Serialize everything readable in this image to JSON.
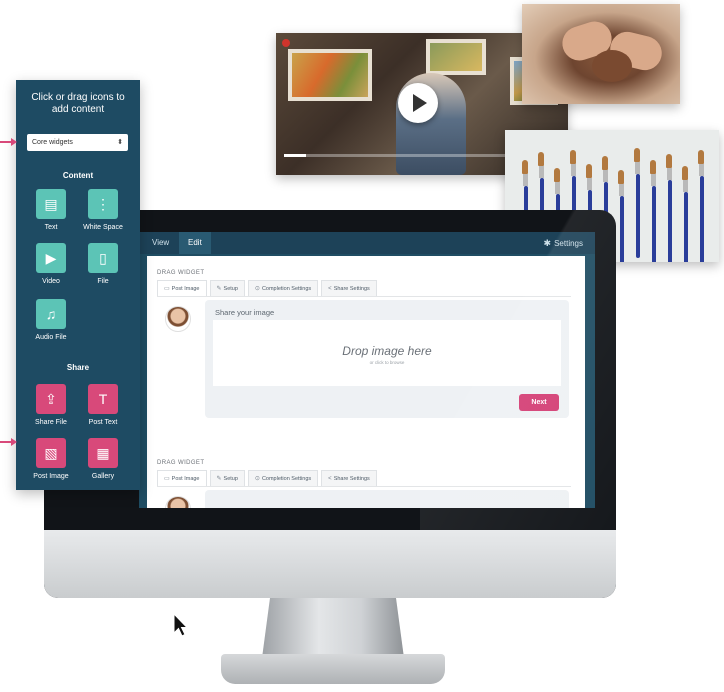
{
  "panel": {
    "title": "Click or drag icons to add content",
    "select_value": "Core widgets",
    "content_heading": "Content",
    "content_items": [
      {
        "label": "Text",
        "icon": "text-document-icon"
      },
      {
        "label": "White Space",
        "icon": "white-space-icon"
      },
      {
        "label": "Video",
        "icon": "video-icon"
      },
      {
        "label": "File",
        "icon": "file-icon"
      },
      {
        "label": "Audio File",
        "icon": "audio-file-icon"
      }
    ],
    "share_heading": "Share",
    "share_items": [
      {
        "label": "Share File",
        "icon": "share-file-icon"
      },
      {
        "label": "Post Text",
        "icon": "post-text-icon"
      },
      {
        "label": "Post Image",
        "icon": "post-image-icon"
      },
      {
        "label": "Gallery",
        "icon": "gallery-icon"
      }
    ]
  },
  "app": {
    "tabs": [
      "View",
      "Edit"
    ],
    "settings_label": "Settings",
    "widgets": [
      {
        "title": "DRAG WIDGET",
        "tabs": [
          "Post Image",
          "Setup",
          "Completion Settings",
          "Share Settings"
        ],
        "share_title": "Share your image",
        "drop_title": "Drop image here",
        "drop_sub": "or click to browse",
        "next_label": "Next"
      },
      {
        "title": "DRAG WIDGET",
        "tabs": [
          "Post Image",
          "Setup",
          "Completion Settings",
          "Share Settings"
        ]
      }
    ]
  },
  "video": {
    "progress": 0.08
  },
  "colors": {
    "panel_bg": "#1e4b63",
    "teal_tile": "#5cc4b6",
    "pink_accent": "#d8497a",
    "next_button": "#d43f75"
  }
}
